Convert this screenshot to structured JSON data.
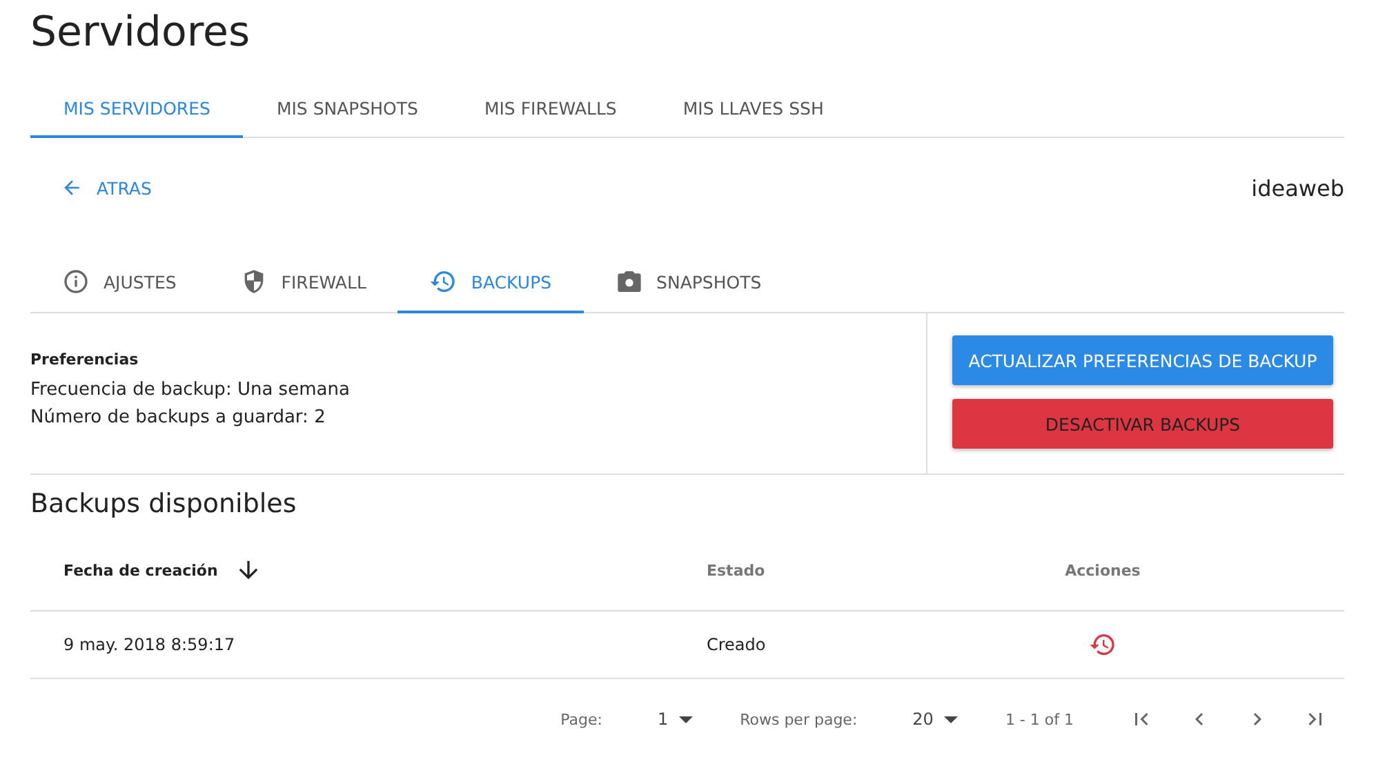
{
  "page": {
    "title": "Servidores"
  },
  "main_tabs": [
    {
      "label": "MIS SERVIDORES",
      "selected": true
    },
    {
      "label": "MIS SNAPSHOTS",
      "selected": false
    },
    {
      "label": "MIS FIREWALLS",
      "selected": false
    },
    {
      "label": "MIS LLAVES SSH",
      "selected": false
    }
  ],
  "back_link": {
    "label": "ATRAS"
  },
  "server_name": "ideaweb",
  "server_tabs": [
    {
      "label": "AJUSTES",
      "kind": "info",
      "selected": false
    },
    {
      "label": "FIREWALL",
      "kind": "shield",
      "selected": false
    },
    {
      "label": "BACKUPS",
      "kind": "history",
      "selected": true
    },
    {
      "label": "SNAPSHOTS",
      "kind": "camera",
      "selected": false
    }
  ],
  "preferences": {
    "heading": "Preferencias",
    "lines": [
      "Frecuencia de backup: Una semana",
      "Número de backups a guardar: 2"
    ]
  },
  "buttons": [
    {
      "label": "ACTUALIZAR PREFERENCIAS DE BACKUP",
      "kind": "primary"
    },
    {
      "label": "DESACTIVAR BACKUPS",
      "kind": "danger"
    }
  ],
  "backups": {
    "title": "Backups disponibles",
    "columns": [
      {
        "label": "Fecha de creación",
        "sorted": true
      },
      {
        "label": "Estado",
        "sorted": false
      },
      {
        "label": "Acciones",
        "sorted": false
      }
    ],
    "rows": [
      {
        "cells": [
          "9 may. 2018 8:59:17",
          "Creado"
        ]
      }
    ]
  },
  "pagination": {
    "page_label": "Page:",
    "page": "1",
    "rows_label": "Rows per page:",
    "rows": "20",
    "range": "1 - 1 of 1"
  }
}
